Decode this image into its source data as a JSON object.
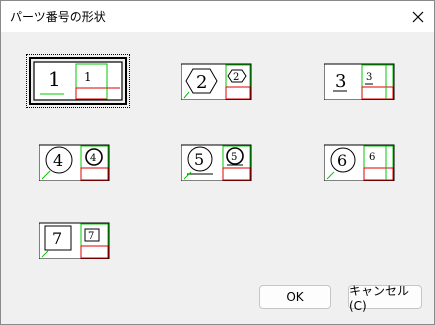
{
  "window": {
    "title": "パーツ番号の形状"
  },
  "options": [
    {
      "id": "plain",
      "number": "1"
    },
    {
      "id": "hexagon",
      "number": "2"
    },
    {
      "id": "underline",
      "number": "3"
    },
    {
      "id": "circle",
      "number": "4"
    },
    {
      "id": "circle-underline",
      "number": "5"
    },
    {
      "id": "circle-large",
      "number": "6"
    },
    {
      "id": "square",
      "number": "7"
    }
  ],
  "buttons": {
    "ok": "OK",
    "cancel": "キャンセル(C)"
  },
  "colors": {
    "accent_green": "#00c800",
    "accent_red": "#e00000"
  }
}
